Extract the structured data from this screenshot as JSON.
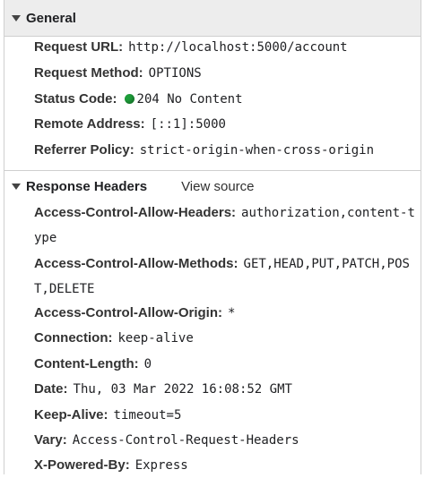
{
  "general": {
    "title": "General",
    "request_url_label": "Request URL:",
    "request_url": "http://localhost:5000/account",
    "request_method_label": "Request Method:",
    "request_method": "OPTIONS",
    "status_code_label": "Status Code:",
    "status_code": "204 No Content",
    "remote_address_label": "Remote Address:",
    "remote_address": "[::1]:5000",
    "referrer_policy_label": "Referrer Policy:",
    "referrer_policy": "strict-origin-when-cross-origin"
  },
  "response_headers": {
    "title": "Response Headers",
    "view_source": "View source",
    "items": [
      {
        "key": "Access-Control-Allow-Headers:",
        "value": "authorization,content-t",
        "cont": "ype"
      },
      {
        "key": "Access-Control-Allow-Methods:",
        "value": "GET,HEAD,PUT,PATCH,POS",
        "cont": "T,DELETE"
      },
      {
        "key": "Access-Control-Allow-Origin:",
        "value": "*"
      },
      {
        "key": "Connection:",
        "value": "keep-alive"
      },
      {
        "key": "Content-Length:",
        "value": "0"
      },
      {
        "key": "Date:",
        "value": "Thu, 03 Mar 2022 16:08:52 GMT"
      },
      {
        "key": "Keep-Alive:",
        "value": "timeout=5"
      },
      {
        "key": "Vary:",
        "value": "Access-Control-Request-Headers"
      },
      {
        "key": "X-Powered-By:",
        "value": "Express"
      }
    ]
  },
  "colors": {
    "status_dot": "#1e9e3a",
    "header_bg": "#ededed"
  }
}
